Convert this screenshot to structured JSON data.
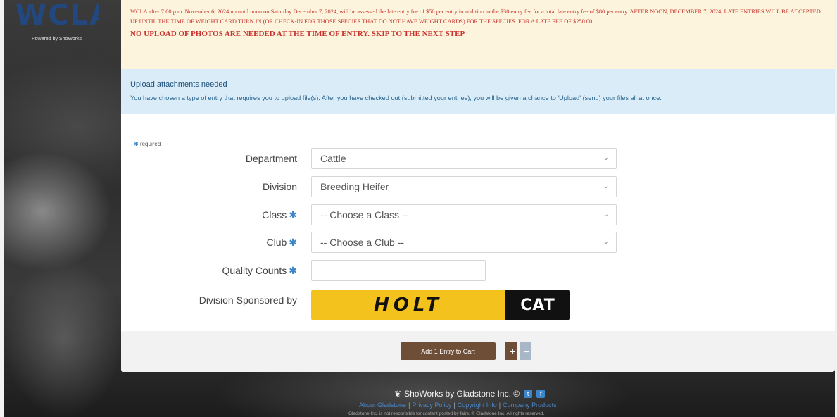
{
  "brand": {
    "logo_text": "WCLA",
    "powered_by": "Powered by ShoWorks"
  },
  "notice": {
    "text": "WCLA after 7:00 p.m. November 6, 2024 up until noon on Saturday December 7, 2024, will be assessed the late entry fee of $50 per entry in addition to the $30 entry fee for a total late entry fee of $80 per entry. AFTER NOON, DECEMBER 7, 2024, LATE ENTRIES WILL BE ACCEPTED UP UNTIL THE TIME OF WEIGHT CARD TURN IN (OR CHECK-IN FOR THOSE SPECIES THAT DO NOT HAVE WEIGHT CARDS) FOR THE SPECIES. FOR A LATE FEE OF $250.00.",
    "link": "NO UPLOAD OF PHOTOS ARE NEEDED AT THE TIME OF ENTRY. SKIP TO THE NEXT STEP"
  },
  "upload": {
    "title": "Upload attachments needed",
    "text": "You have chosen a type of entry that requires you to upload file(s). After you have checked out (submitted your entries), you will be given a chance to 'Upload' (send) your files all at once."
  },
  "form": {
    "required_label": "required",
    "department": {
      "label": "Department",
      "value": "Cattle"
    },
    "division": {
      "label": "Division",
      "value": "Breeding Heifer"
    },
    "class": {
      "label": "Class",
      "placeholder": "-- Choose a Class --"
    },
    "club": {
      "label": "Club",
      "placeholder": "-- Choose a Club --"
    },
    "quality_counts": {
      "label": "Quality Counts",
      "value": ""
    },
    "sponsor": {
      "label": "Division Sponsored by",
      "holt": "HOLT",
      "cat": "CAT"
    }
  },
  "cart": {
    "add_label": "Add 1 Entry to Cart",
    "plus": "+",
    "minus": "−"
  },
  "footer": {
    "brand": "ShoWorks by Gladstone Inc. ©",
    "links": [
      "About Gladstone",
      "Privacy Policy",
      "Copyright Info",
      "Company Products"
    ],
    "disclaimer": "Gladstone Inc. is not responsible for content posted by fairs. © Gladstone Inc. All rights reserved."
  },
  "colors": {
    "notice_red": "#c9322d",
    "info_bg": "#d9ecf7",
    "required_blue": "#3a86c8",
    "cart_brown": "#6f4e37",
    "sponsor_yellow": "#f4c21c"
  }
}
